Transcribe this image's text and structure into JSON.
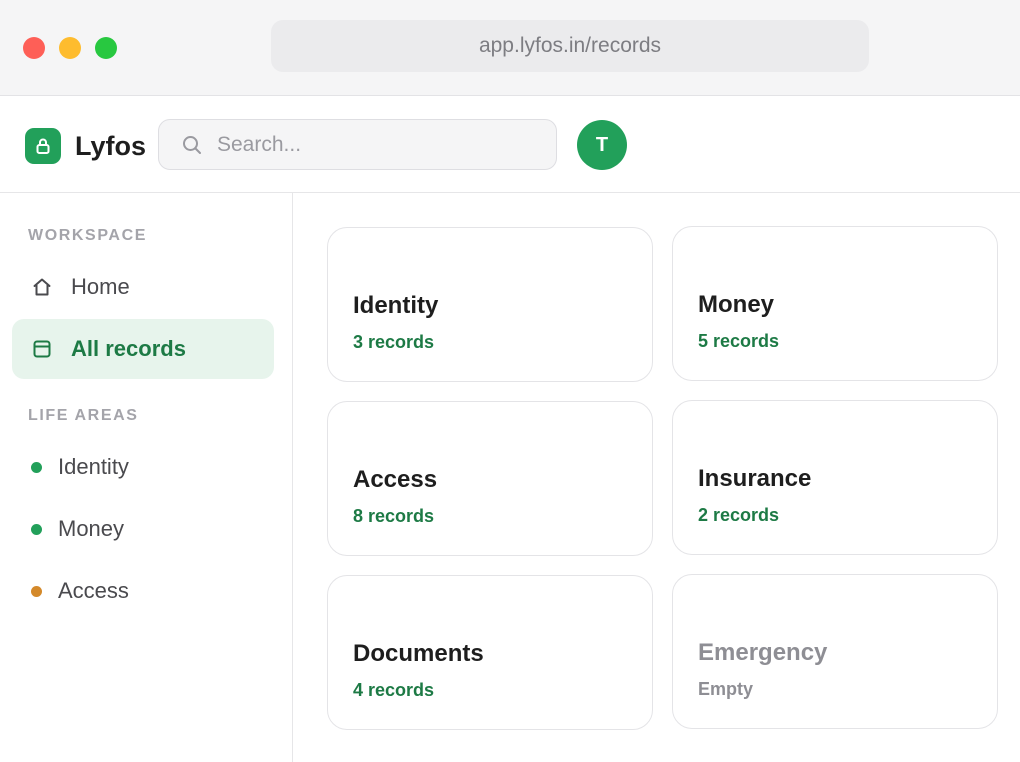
{
  "browser": {
    "url": "app.lyfos.in/records"
  },
  "header": {
    "brand": "Lyfos",
    "logo_icon": "lock-icon",
    "search_placeholder": "Search...",
    "avatar_initial": "T"
  },
  "sidebar": {
    "workspace_label": "WORKSPACE",
    "workspace_items": [
      {
        "label": "Home",
        "icon": "home-icon",
        "active": false
      },
      {
        "label": "All records",
        "icon": "calendar-icon",
        "active": true
      }
    ],
    "life_areas_label": "LIFE AREAS",
    "life_areas": [
      {
        "label": "Identity",
        "color": "#22a05a"
      },
      {
        "label": "Money",
        "color": "#22a05a"
      },
      {
        "label": "Access",
        "color": "#d4892a"
      }
    ]
  },
  "cards": [
    {
      "title": "Identity",
      "count": "3 records",
      "empty": false
    },
    {
      "title": "Money",
      "count": "5 records",
      "empty": false
    },
    {
      "title": "Access",
      "count": "8 records",
      "empty": false
    },
    {
      "title": "Insurance",
      "count": "2 records",
      "empty": false
    },
    {
      "title": "Documents",
      "count": "4 records",
      "empty": false
    },
    {
      "title": "Emergency",
      "count": "Empty",
      "empty": true
    }
  ],
  "colors": {
    "accent": "#22a05a",
    "accent_text": "#1d7a45",
    "active_bg": "#e7f4ec"
  }
}
